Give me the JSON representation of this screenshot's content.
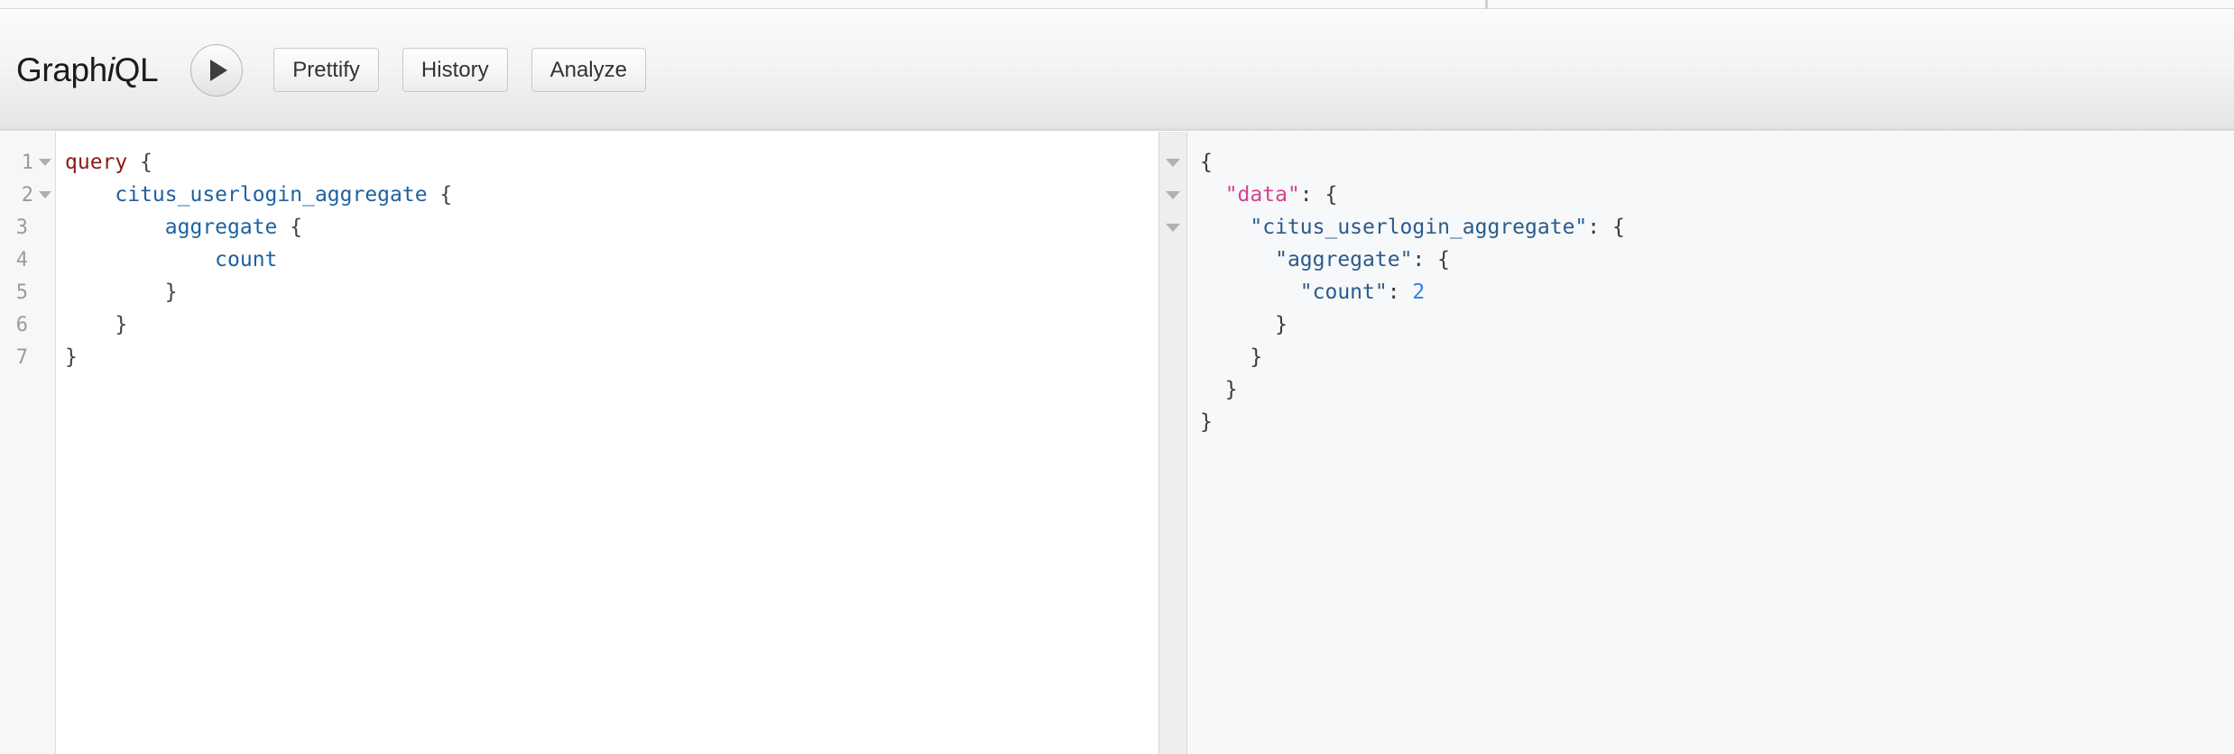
{
  "app": {
    "logo_prefix": "Graph",
    "logo_italic": "i",
    "logo_suffix": "QL"
  },
  "toolbar": {
    "execute_label": "▶",
    "buttons": [
      {
        "label": "Prettify",
        "name": "prettify-button"
      },
      {
        "label": "History",
        "name": "history-button"
      },
      {
        "label": "Analyze",
        "name": "analyze-button"
      }
    ]
  },
  "query_editor": {
    "line_numbers": [
      "1",
      "2",
      "3",
      "4",
      "5",
      "6",
      "7"
    ],
    "foldable_lines": [
      1,
      2
    ],
    "lines": [
      {
        "indent": "",
        "kw": "query",
        "after": " {"
      },
      {
        "indent": "    ",
        "field": "citus_userlogin_aggregate",
        "after": " {"
      },
      {
        "indent": "        ",
        "field": "aggregate",
        "after": " {"
      },
      {
        "indent": "            ",
        "field": "count",
        "after": ""
      },
      {
        "indent": "        ",
        "punct": "}"
      },
      {
        "indent": "    ",
        "punct": "}"
      },
      {
        "indent": "",
        "punct": "}"
      }
    ],
    "raw_text": "query {\n    citus_userlogin_aggregate {\n        aggregate {\n            count\n        }\n    }\n}"
  },
  "result_panel": {
    "fold_carets": 3,
    "lines": [
      {
        "indent": "",
        "punct": "{"
      },
      {
        "indent": "  ",
        "data_key": "\"data\"",
        "after": ": {"
      },
      {
        "indent": "    ",
        "key": "\"citus_userlogin_aggregate\"",
        "after": ": {"
      },
      {
        "indent": "      ",
        "key": "\"aggregate\"",
        "after": ": {"
      },
      {
        "indent": "        ",
        "key": "\"count\"",
        "colon": ": ",
        "num": "2"
      },
      {
        "indent": "      ",
        "punct": "}"
      },
      {
        "indent": "    ",
        "punct": "}"
      },
      {
        "indent": "  ",
        "punct": "}"
      },
      {
        "indent": "",
        "punct": "}"
      }
    ],
    "raw_json": "{\n  \"data\": {\n    \"citus_userlogin_aggregate\": {\n      \"aggregate\": {\n        \"count\": 2\n      }\n    }\n  }\n}",
    "count_value": "2"
  },
  "colors": {
    "keyword": "#8b1a1a",
    "field": "#1f61a0",
    "json_data_key": "#d64292",
    "json_key": "#2a5b8c",
    "json_number": "#2f80e0",
    "toolbar_bg": "#f0f0f0",
    "result_bg": "#f7f8f9"
  }
}
